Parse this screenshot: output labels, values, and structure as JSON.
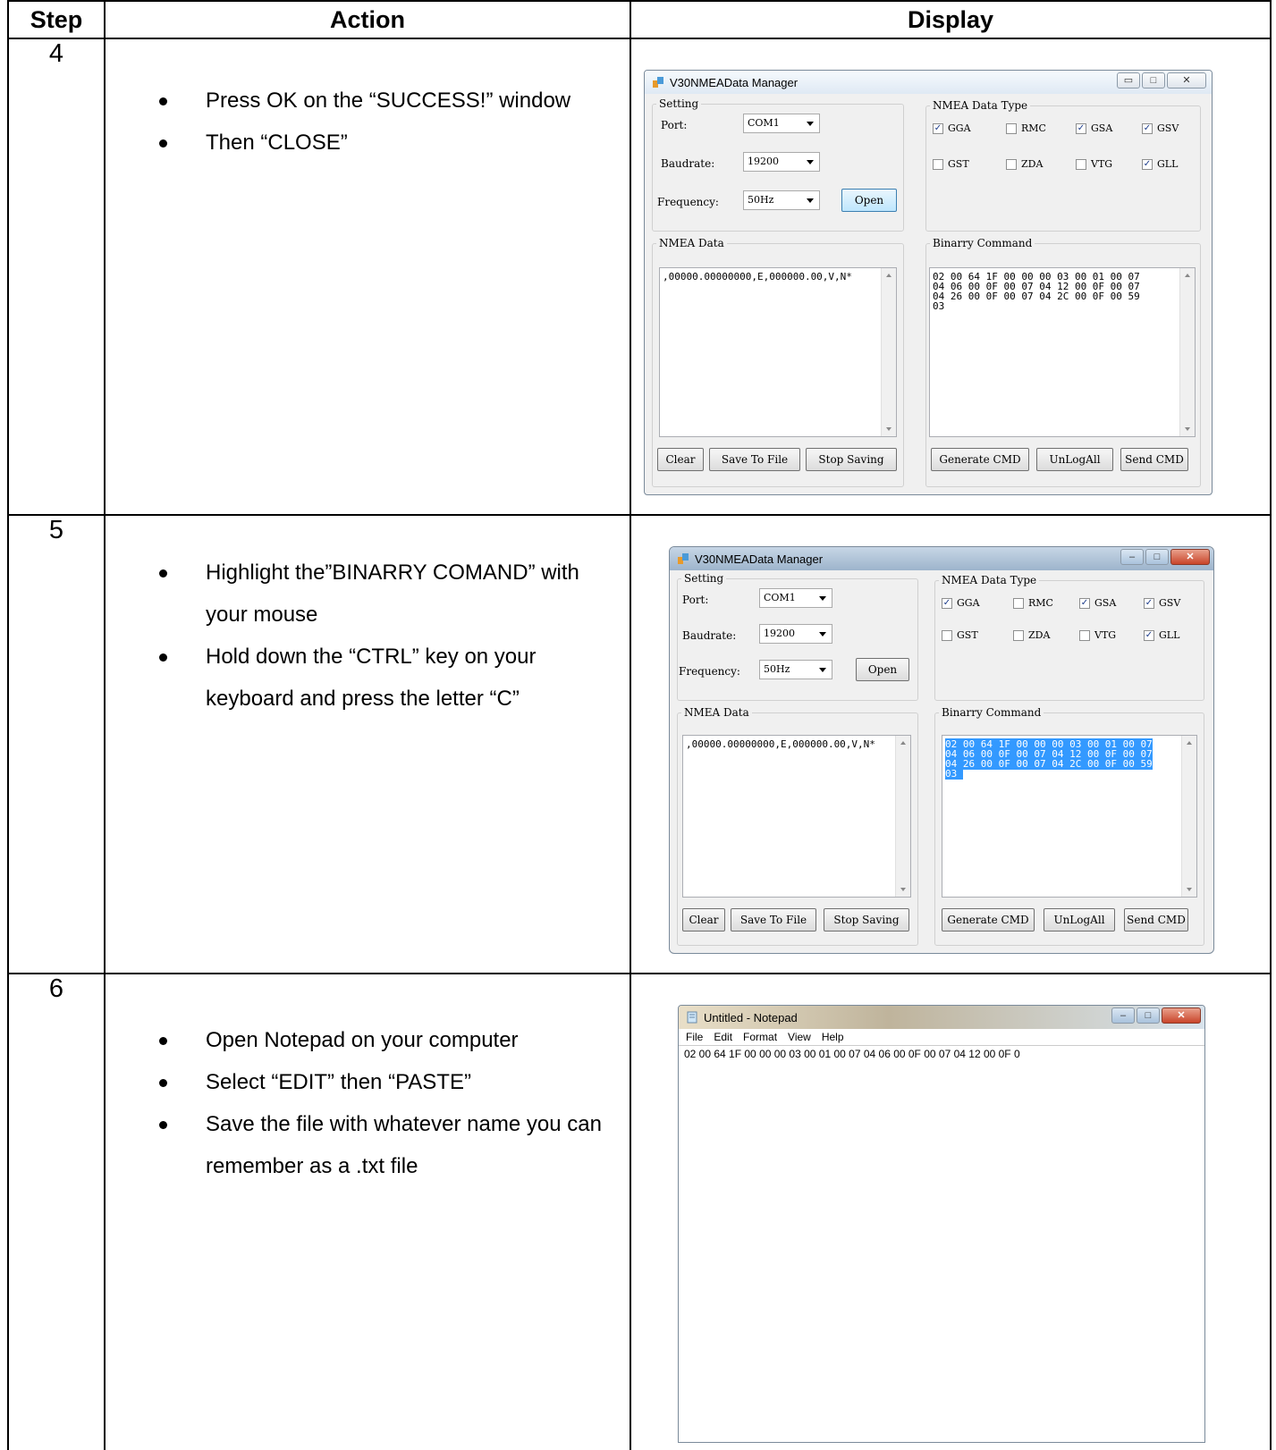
{
  "headers": {
    "step": "Step",
    "action": "Action",
    "display": "Display"
  },
  "rows": [
    {
      "step": "4",
      "actions": [
        "Press OK on the “SUCCESS!” window",
        "Then “CLOSE”"
      ]
    },
    {
      "step": "5",
      "actions": [
        "Highlight the”BINARRY COMAND” with your mouse",
        "Hold down the “CTRL” key on your keyboard and press the letter “C”"
      ]
    },
    {
      "step": "6",
      "actions": [
        "Open Notepad on your computer",
        "Select “EDIT” then “PASTE”",
        "Save the file with whatever name you can remember as a .txt file"
      ]
    }
  ],
  "app": {
    "title": "V30NMEAData Manager",
    "setting_legend": "Setting",
    "port_label": "Port:",
    "port_value": "COM1",
    "baud_label": "Baudrate:",
    "baud_value": "19200",
    "freq_label": "Frequency:",
    "freq_value": "50Hz",
    "open_label": "Open",
    "type_legend": "NMEA Data Type",
    "types": [
      {
        "label": "GGA",
        "checked": true
      },
      {
        "label": "RMC",
        "checked": false
      },
      {
        "label": "GSA",
        "checked": true
      },
      {
        "label": "GSV",
        "checked": true
      },
      {
        "label": "GST",
        "checked": false
      },
      {
        "label": "ZDA",
        "checked": false
      },
      {
        "label": "VTG",
        "checked": false
      },
      {
        "label": "GLL",
        "checked": true
      }
    ],
    "nmea_legend": "NMEA  Data",
    "nmea_text": ",00000.00000000,E,000000.00,V,N*",
    "binary_legend": "Binarry Command",
    "binary_lines": [
      "02 00 64 1F 00 00 00 03 00 01 00 07",
      "04 06 00 0F 00 07 04 12 00 0F 00 07",
      "04 26 00 0F 00 07 04 2C 00 0F 00 59",
      "03"
    ],
    "clear_label": "Clear",
    "save_label": "Save To File",
    "stop_label": "Stop Saving",
    "generate_label": "Generate CMD",
    "unlog_label": "UnLogAll",
    "send_label": "Send CMD"
  },
  "notepad": {
    "title": "Untitled - Notepad",
    "menu": [
      "File",
      "Edit",
      "Format",
      "View",
      "Help"
    ],
    "text": "02 00 64 1F 00 00 00 03 00 01 00 07 04 06 00 0F 00 07 04 12 00 0F 0"
  },
  "colors": {
    "selection": "#3399ff",
    "check": "#1a3a8a"
  }
}
